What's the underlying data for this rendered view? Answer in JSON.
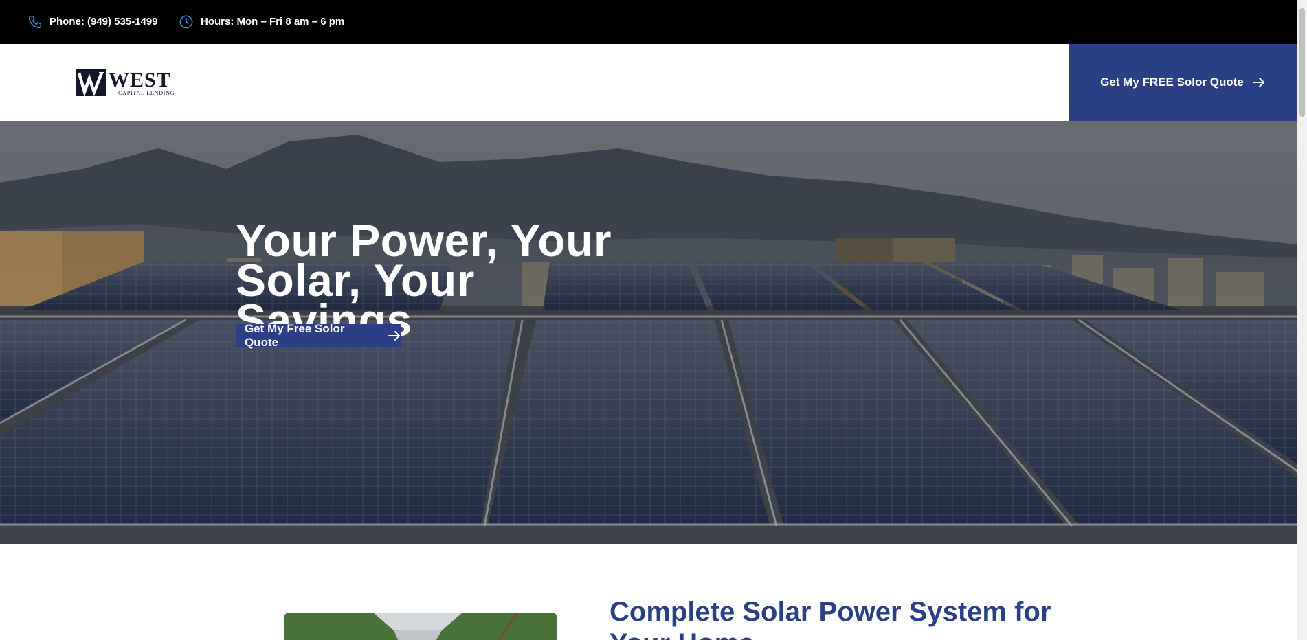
{
  "topbar": {
    "phone": "Phone: (949) 535-1499",
    "hours": "Hours: Mon – Fri 8 am – 6 pm",
    "phone_icon": "phone-icon",
    "hours_icon": "clock-icon"
  },
  "header": {
    "logo_main": "WEST",
    "logo_sub": "CAPITAL LENDING",
    "cta_label": "Get My FREE Solor Quote"
  },
  "hero": {
    "title_line1": "Your Power, Your",
    "title_line2": "Solar, Your Savings",
    "cta_label": "Get My Free Solor Quote"
  },
  "content": {
    "heading": "Complete Solar Power System for Your Home"
  },
  "colors": {
    "brand_blue": "#2a3f84",
    "topbar_bg": "#000000",
    "icon_blue": "#3a8fd9"
  }
}
